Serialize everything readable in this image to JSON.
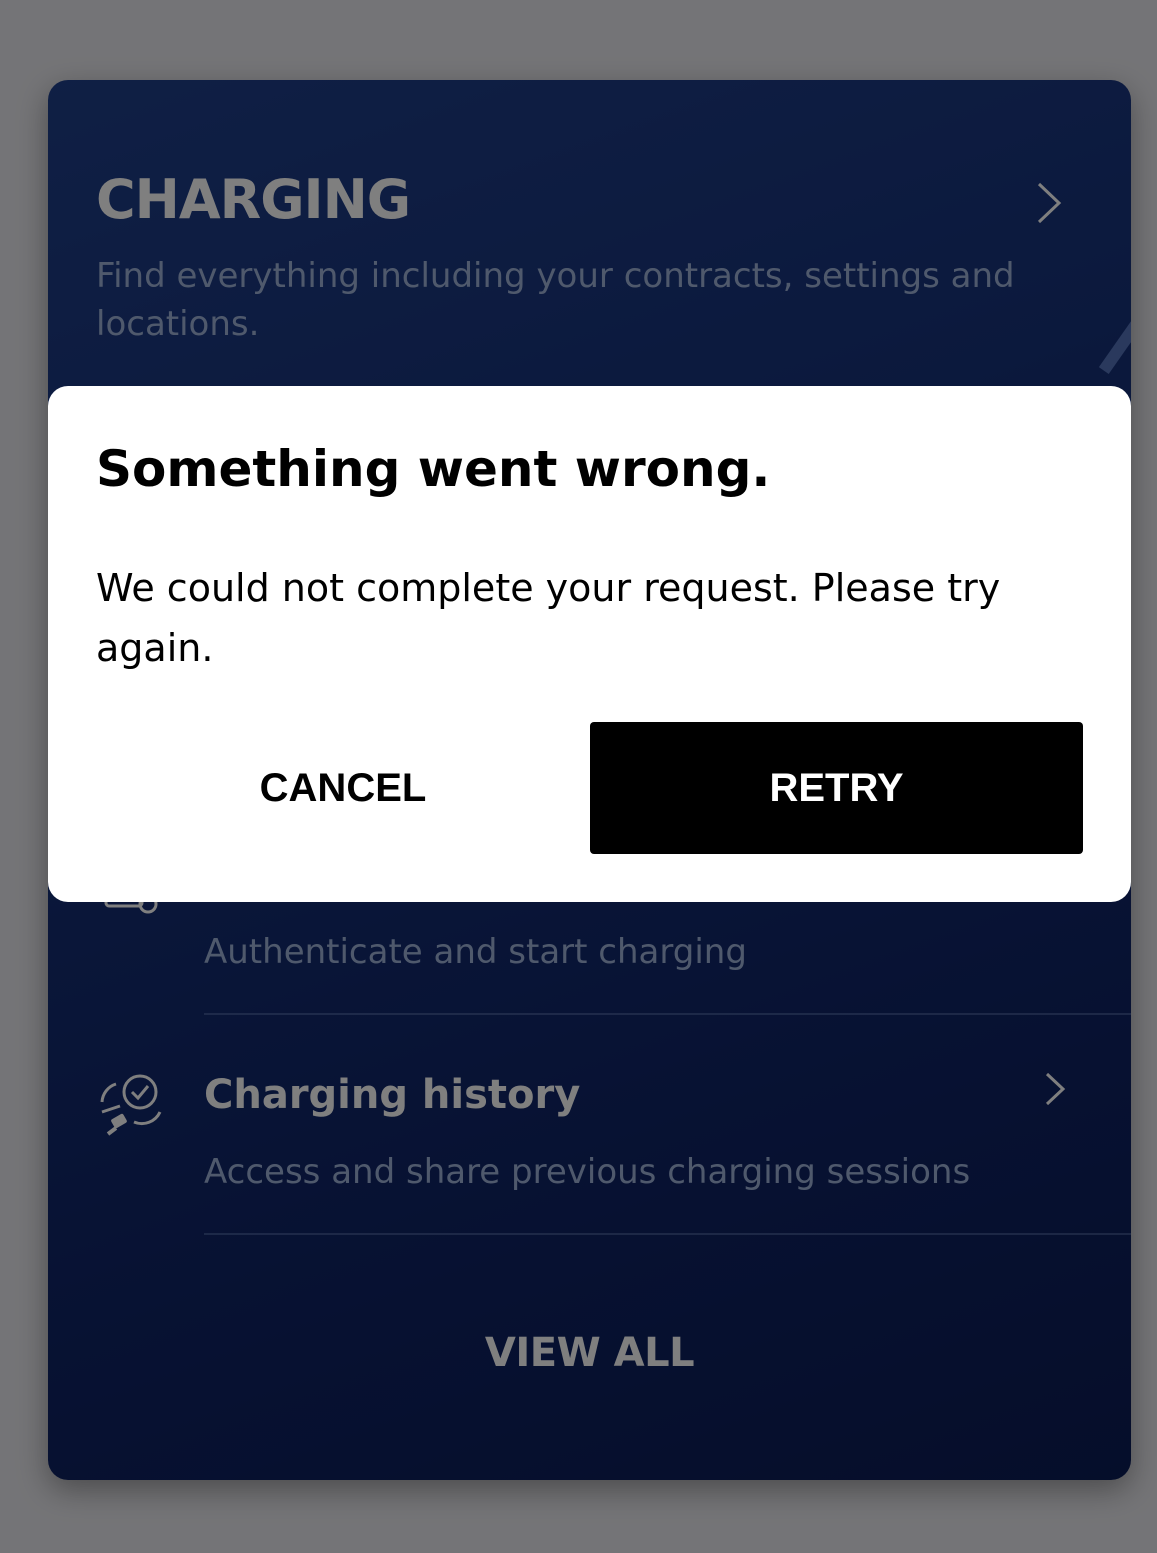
{
  "card": {
    "title": "CHARGING",
    "subtitle": "Find everything including your contracts, settings and locations.",
    "rows": [
      {
        "title": "",
        "subtitle": "Authenticate and start charging",
        "icon": "charging-card-icon"
      },
      {
        "title": "Charging history",
        "subtitle": "Access and share previous charging sessions",
        "icon": "charging-history-icon"
      }
    ],
    "view_all": "VIEW ALL"
  },
  "dialog": {
    "title": "Something went wrong.",
    "message": "We could not complete your request. Please try again.",
    "cancel_label": "CANCEL",
    "retry_label": "RETRY"
  },
  "colors": {
    "card_gradient_start": "#1f3f8a",
    "card_gradient_end": "#0b1c55",
    "subtitle": "#9fb3d9",
    "dialog_bg": "#ffffff",
    "primary_button": "#000000"
  }
}
